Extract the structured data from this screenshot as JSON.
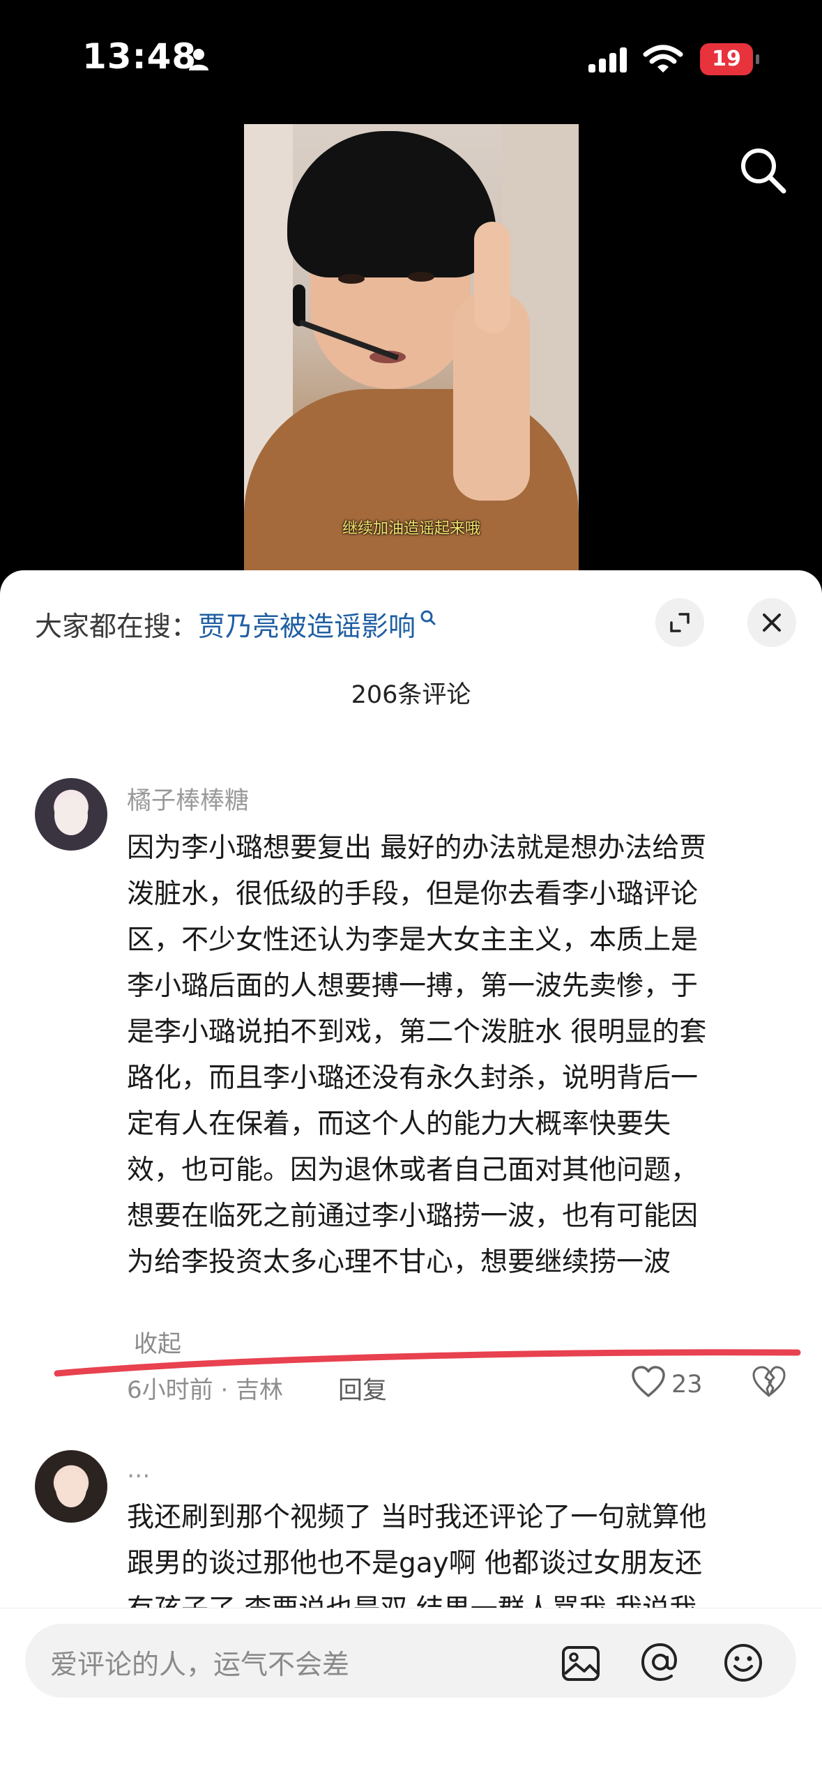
{
  "status_bar": {
    "time": "13:48",
    "battery": "19"
  },
  "video": {
    "subtitle": "继续加油造谣起来哦"
  },
  "sheet": {
    "trending_prefix": "大家都在搜：",
    "trending_term": "贾乃亮被造谣影响",
    "comment_count": "206条评论"
  },
  "comments": [
    {
      "username": "橘子棒棒糖",
      "lines": [
        "因为李小璐想要复出 最好的办法就是想办法给贾",
        "泼脏水，很低级的手段，但是你去看李小璐评论",
        "区，不少女性还认为李是大女主主义，本质上是",
        "李小璐后面的人想要搏一搏，第一波先卖惨，于",
        "是李小璐说拍不到戏，第二个泼脏水 很明显的套",
        "路化，而且李小璐还没有永久封杀，说明背后一",
        "定有人在保着，而这个人的能力大概率快要失",
        "效，也可能。因为退休或者自己面对其他问题，",
        "想要在临死之前通过李小璐捞一波，也有可能因",
        "为给李投资太多心理不甘心，想要继续捞一波"
      ],
      "collapse_label": "收起",
      "meta": "6小时前 · 吉林",
      "reply_label": "回复",
      "likes": "23"
    },
    {
      "username": "...",
      "lines": [
        "我还刷到那个视频了 当时我还评论了一句就算他",
        "跟男的谈过那他也不是gay啊 他都谈过女朋友还",
        "有孩子了 李要说也是双 结果一群人骂我 我说我"
      ]
    }
  ],
  "input_bar": {
    "placeholder": "爱评论的人，运气不会差"
  },
  "colors": {
    "link_blue": "#1f5fa3",
    "annotation_red": "#e8414f",
    "battery_red": "#e8323c"
  },
  "icons": [
    "person-icon",
    "signal-icon",
    "wifi-icon",
    "search-icon",
    "expand-icon",
    "close-icon",
    "heart-icon",
    "dislike-heart-icon",
    "image-icon",
    "at-icon",
    "emoji-icon"
  ]
}
